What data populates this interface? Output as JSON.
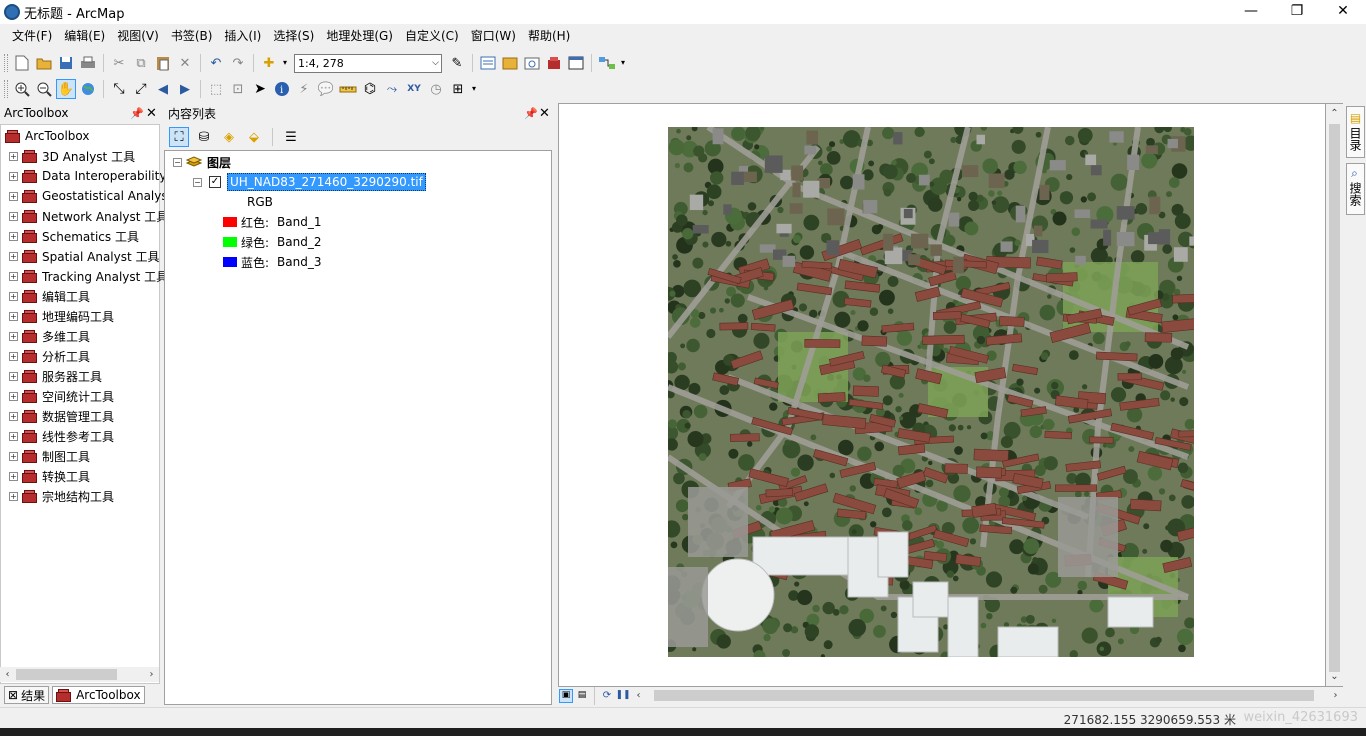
{
  "window": {
    "title": "无标题 - ArcMap",
    "min": "—",
    "max": "❐",
    "close": "✕"
  },
  "menu": [
    "文件(F)",
    "编辑(E)",
    "视图(V)",
    "书签(B)",
    "插入(I)",
    "选择(S)",
    "地理处理(G)",
    "自定义(C)",
    "窗口(W)",
    "帮助(H)"
  ],
  "toolbar": {
    "scale": "1:4, 278"
  },
  "arctoolbox": {
    "title": "ArcToolbox",
    "root": "ArcToolbox",
    "items": [
      "3D Analyst 工具",
      "Data Interoperability",
      "Geostatistical Analyst",
      "Network Analyst 工具",
      "Schematics 工具",
      "Spatial Analyst 工具",
      "Tracking Analyst 工具",
      "编辑工具",
      "地理编码工具",
      "多维工具",
      "分析工具",
      "服务器工具",
      "空间统计工具",
      "数据管理工具",
      "线性参考工具",
      "制图工具",
      "转换工具",
      "宗地结构工具"
    ],
    "tabs": [
      "结果",
      "ArcToolbox"
    ]
  },
  "toc": {
    "title": "内容列表",
    "group": "图层",
    "layer": "UH_NAD83_271460_3290290.tif",
    "rgb": "RGB",
    "bands": [
      {
        "label": "红色:",
        "band": "Band_1",
        "color": "#ff0000"
      },
      {
        "label": "绿色:",
        "band": "Band_2",
        "color": "#00ff00"
      },
      {
        "label": "蓝色:",
        "band": "Band_3",
        "color": "#0000ff"
      }
    ]
  },
  "right_dock": {
    "tabs": [
      "目录",
      "搜索"
    ]
  },
  "status": {
    "coords": "271682.155  3290659.553 米",
    "watermark": "weixin_42631693"
  }
}
